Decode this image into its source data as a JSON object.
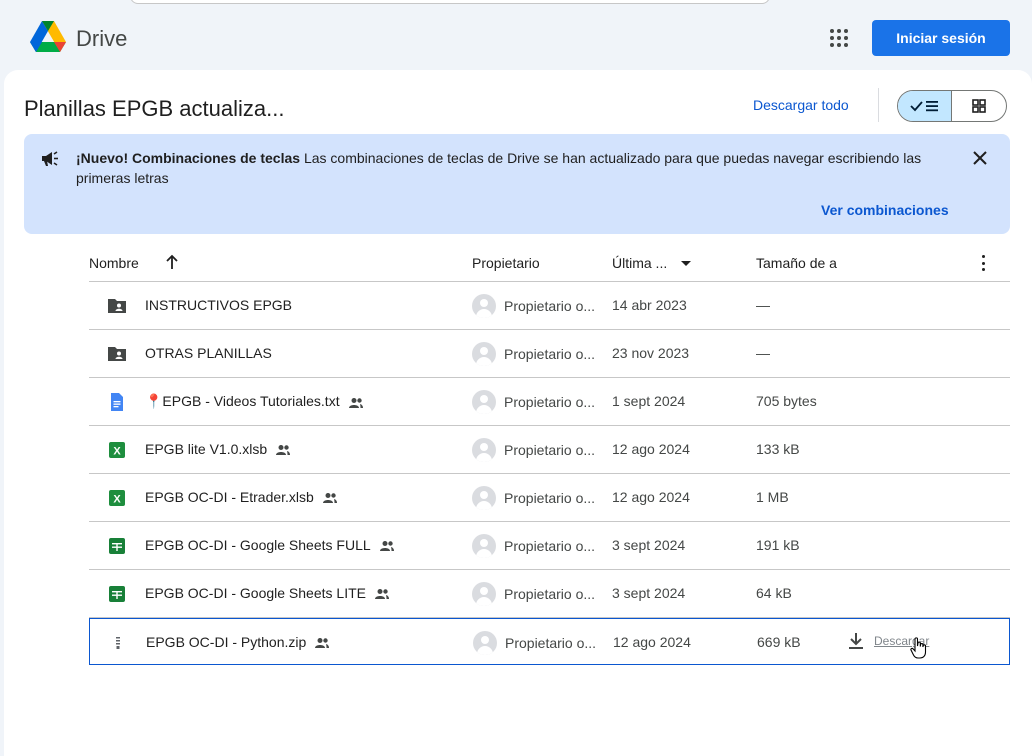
{
  "header": {
    "app_name": "Drive",
    "signin_label": "Iniciar sesión"
  },
  "page": {
    "title": "Planillas EPGB actualiza...",
    "download_all": "Descargar todo"
  },
  "banner": {
    "headline": "¡Nuevo! Combinaciones de teclas",
    "body": "Las combinaciones de teclas de Drive se han actualizado para que puedas navegar escribiendo las primeras letras",
    "link": "Ver combinaciones"
  },
  "columns": {
    "name": "Nombre",
    "owner": "Propietario",
    "modified": "Última ...",
    "size": "Tamaño de a"
  },
  "files": [
    {
      "name": "INSTRUCTIVOS EPGB",
      "icon": "shared-folder-icon",
      "owner": "Propietario o...",
      "date": "14 abr 2023",
      "size": "—",
      "shared": false
    },
    {
      "name": "OTRAS PLANILLAS",
      "icon": "shared-folder-icon",
      "owner": "Propietario o...",
      "date": "23 nov 2023",
      "size": "—",
      "shared": false
    },
    {
      "name": "📍EPGB - Videos Tutoriales.txt",
      "icon": "doc-icon",
      "owner": "Propietario o...",
      "date": "1 sept 2024",
      "size": "705 bytes",
      "shared": true
    },
    {
      "name": "EPGB lite V1.0.xlsb",
      "icon": "excel-icon",
      "owner": "Propietario o...",
      "date": "12 ago 2024",
      "size": "133 kB",
      "shared": true
    },
    {
      "name": "EPGB OC-DI - Etrader.xlsb",
      "icon": "excel-icon",
      "owner": "Propietario o...",
      "date": "12 ago 2024",
      "size": "1 MB",
      "shared": true
    },
    {
      "name": "EPGB OC-DI - Google Sheets FULL",
      "icon": "sheets-icon",
      "owner": "Propietario o...",
      "date": "3 sept 2024",
      "size": "191 kB",
      "shared": true
    },
    {
      "name": "EPGB OC-DI - Google Sheets LITE",
      "icon": "sheets-icon",
      "owner": "Propietario o...",
      "date": "3 sept 2024",
      "size": "64 kB",
      "shared": true
    },
    {
      "name": "EPGB OC-DI - Python.zip",
      "icon": "zip-icon",
      "owner": "Propietario o...",
      "date": "12 ago 2024",
      "size": "669 kB",
      "shared": true,
      "selected": true,
      "download_label": "Descargar"
    }
  ],
  "colors": {
    "accent": "#1a73e8",
    "banner_bg": "#d3e3fd",
    "link": "#0b57d0",
    "excel": "#1e8e3e",
    "sheets": "#188038",
    "doc": "#4285f4"
  }
}
